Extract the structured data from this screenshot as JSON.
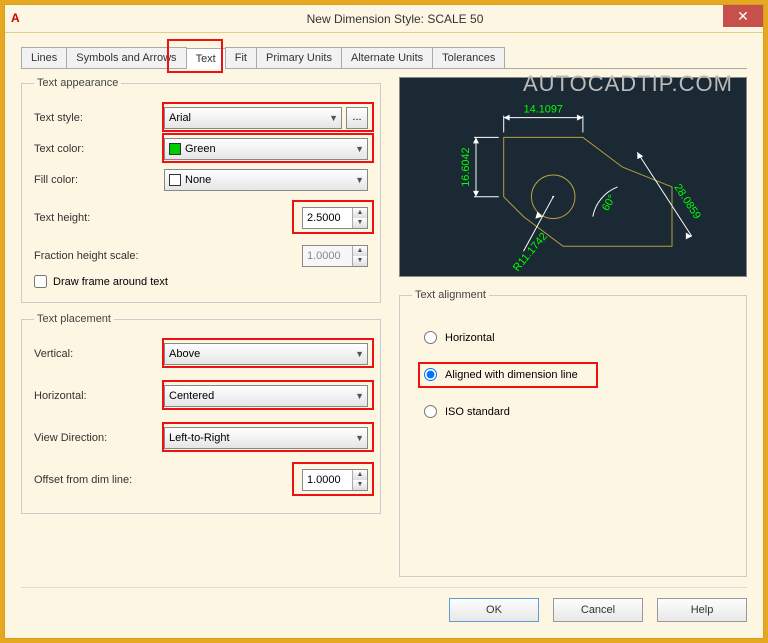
{
  "window": {
    "title": "New Dimension Style: SCALE 50",
    "watermark": "AUTOCADTIP.COM"
  },
  "tabs": [
    "Lines",
    "Symbols and Arrows",
    "Text",
    "Fit",
    "Primary Units",
    "Alternate Units",
    "Tolerances"
  ],
  "active_tab": "Text",
  "appearance": {
    "legend": "Text appearance",
    "style_label": "Text style:",
    "style_value": "Arial",
    "style_browse": "...",
    "color_label": "Text color:",
    "color_value": "Green",
    "fill_label": "Fill color:",
    "fill_value": "None",
    "height_label": "Text height:",
    "height_value": "2.5000",
    "frac_label": "Fraction height scale:",
    "frac_value": "1.0000",
    "frame_label": "Draw frame around text"
  },
  "placement": {
    "legend": "Text placement",
    "vertical_label": "Vertical:",
    "vertical_value": "Above",
    "horizontal_label": "Horizontal:",
    "horizontal_value": "Centered",
    "viewdir_label": "View Direction:",
    "viewdir_value": "Left-to-Right",
    "offset_label": "Offset from dim line:",
    "offset_value": "1.0000"
  },
  "alignment": {
    "legend": "Text alignment",
    "horizontal": "Horizontal",
    "aligned": "Aligned with dimension line",
    "iso": "ISO standard"
  },
  "preview_dims": {
    "top": "14.1097",
    "left": "16.6042",
    "right": "28.0859",
    "angle": "60°",
    "radius": "R11.1742"
  },
  "footer": {
    "ok": "OK",
    "cancel": "Cancel",
    "help": "Help"
  }
}
